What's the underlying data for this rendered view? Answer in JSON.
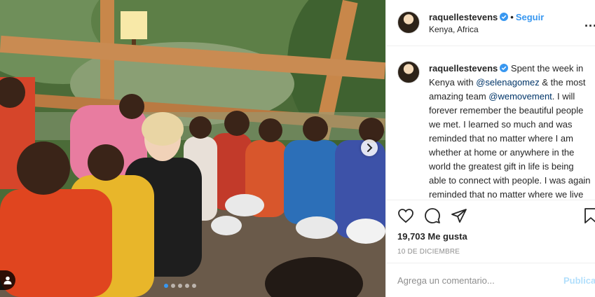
{
  "post": {
    "username": "raquellestevens",
    "follow_label": "Seguir",
    "separator": "•",
    "location": "Kenya, Africa",
    "more_label": "...",
    "caption": {
      "username": "raquellestevens",
      "text_1": "Spent the week in Kenya with",
      "mention_1": "@selenagomez",
      "text_2": "& the most amazing team",
      "mention_2": "@wemovement",
      "text_3": ". I will forever remember the beautiful people we met. I learned so much and was reminded that no matter where I am whether at home or anywhere in the world the greatest gift in life is being able to connect with people. I was again reminded that no matter where we live or what our background is we are all connected through our"
    },
    "likes_label": "19,703 Me gusta",
    "date_label": "10 de diciembre",
    "comment_placeholder": "Agrega un comentario...",
    "publish_label": "Publicar"
  },
  "carousel": {
    "total": 5,
    "active_index": 0
  },
  "icons": {
    "verified": "verified-badge-icon",
    "like": "heart-icon",
    "comment": "comment-bubble-icon",
    "share": "paper-plane-icon",
    "save": "bookmark-icon",
    "next": "chevron-right-icon",
    "tag": "user-tag-icon"
  },
  "colors": {
    "link": "#3897f0",
    "mention": "#003569",
    "text": "#262626",
    "muted": "#8e8e8e",
    "publish_disabled": "#b2dffc"
  }
}
